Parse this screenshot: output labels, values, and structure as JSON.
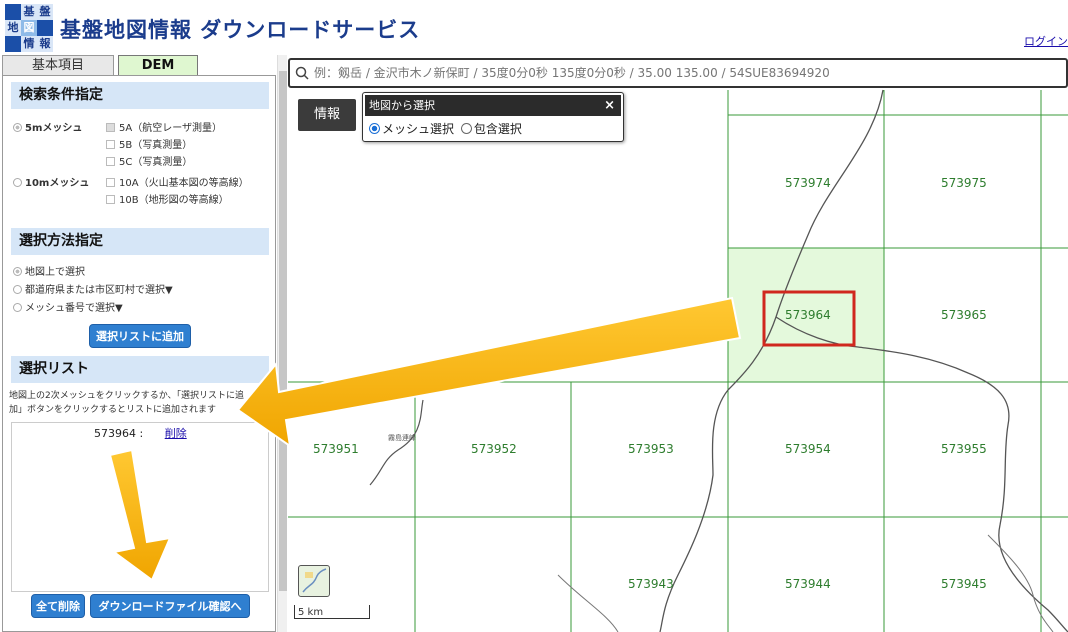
{
  "header": {
    "logo_chars": [
      "基",
      "盤",
      "地",
      "図",
      "情",
      "報"
    ],
    "title": "基盤地図情報 ダウンロードサービス",
    "login_label": "ログイン"
  },
  "tabs": {
    "basic": "基本項目",
    "dem": "DEM"
  },
  "search_conditions": {
    "heading": "検索条件指定",
    "mesh5_label": "5mメッシュ",
    "mesh10_label": "10mメッシュ",
    "types": [
      "5A（航空レーザ測量）",
      "5B（写真測量）",
      "5C（写真測量）",
      "10A（火山基本図の等高線）",
      "10B（地形図の等高線）"
    ]
  },
  "selection_method": {
    "heading": "選択方法指定",
    "options": [
      "地図上で選択",
      "都道府県または市区町村で選択▼",
      "メッシュ番号で選択▼"
    ],
    "add_button": "選択リストに追加"
  },
  "selection_list": {
    "heading": "選択リスト",
    "help_text": [
      "地図上の2次メッシュをクリックするか、「選択リストに追",
      "加」ボタンをクリックするとリストに追加されます"
    ],
    "items": [
      {
        "mesh": "573964 :",
        "delete_label": "削除"
      }
    ],
    "clear_all_button": "全て削除",
    "download_button": "ダウンロードファイル確認へ"
  },
  "map": {
    "search_placeholder": "例：剱岳 / 金沢市木ノ新保町 / 35度0分0秒 135度0分0秒 / 35.00 135.00 / 54SUE83694920",
    "info_button": "情報",
    "popup": {
      "title": "地図から選択",
      "close": "×",
      "option_mesh": "メッシュ選択",
      "option_contain": "包含選択"
    },
    "meshes": [
      {
        "id": "573974"
      },
      {
        "id": "573975"
      },
      {
        "id": "573964",
        "selected": true
      },
      {
        "id": "573965"
      },
      {
        "id": "573951"
      },
      {
        "id": "573952"
      },
      {
        "id": "573953"
      },
      {
        "id": "573954"
      },
      {
        "id": "573955"
      },
      {
        "id": "573943"
      },
      {
        "id": "573944"
      },
      {
        "id": "573945"
      }
    ],
    "map_place_label": "霧島連峰",
    "scale_label": "5 km"
  },
  "colors": {
    "grid_line": "#3a9a3a",
    "mesh_selected_fill": "#e4f9dc",
    "highlight_box": "#d0281e",
    "arrow_fill": "#f5b400",
    "section_head": "#d6e6f7",
    "button_blue": "#2f7fd0"
  }
}
